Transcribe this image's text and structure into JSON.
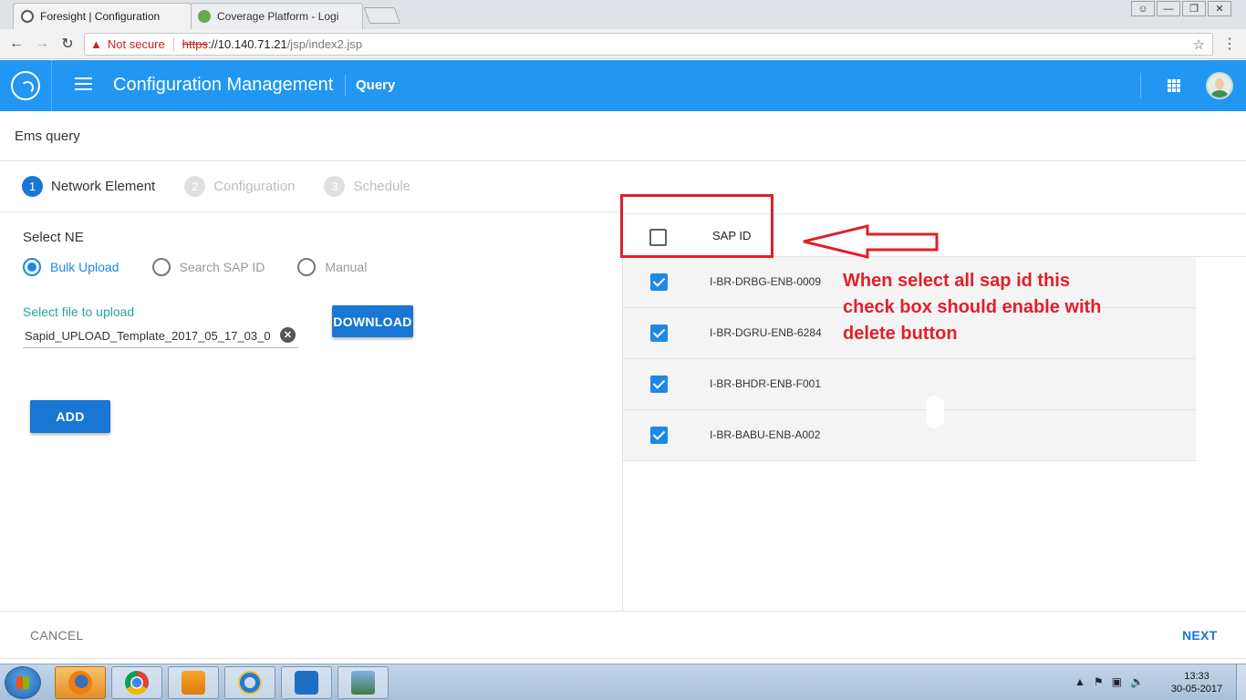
{
  "browser": {
    "tabs": [
      {
        "title": "Foresight | Configuration",
        "active": true
      },
      {
        "title": "Coverage Platform - Logi",
        "active": false
      }
    ],
    "security_label": "Not secure",
    "url_scheme": "https",
    "url_host": "://10.140.71.21",
    "url_path": "/jsp/index2.jsp"
  },
  "app": {
    "title": "Configuration Management",
    "breadcrumb": "Query",
    "brand_color": "#2196f3"
  },
  "page": {
    "title": "Ems query",
    "steps": [
      {
        "number": "1",
        "label": "Network Element",
        "active": true
      },
      {
        "number": "2",
        "label": "Configuration",
        "active": false
      },
      {
        "number": "3",
        "label": "Schedule",
        "active": false
      }
    ],
    "select_ne_label": "Select NE",
    "radios": [
      {
        "label": "Bulk Upload",
        "selected": true
      },
      {
        "label": "Search SAP ID",
        "selected": false
      },
      {
        "label": "Manual",
        "selected": false
      }
    ],
    "file_label": "Select file to upload",
    "file_value": "Sapid_UPLOAD_Template_2017_05_17_03_0",
    "download_label": "DOWNLOAD",
    "add_label": "ADD",
    "cancel_label": "CANCEL",
    "next_label": "NEXT"
  },
  "table": {
    "column_header": "SAP ID",
    "select_all_checked": false,
    "rows": [
      {
        "sap_id": "I-BR-DRBG-ENB-0009",
        "checked": true
      },
      {
        "sap_id": "I-BR-DGRU-ENB-6284",
        "checked": true
      },
      {
        "sap_id": "I-BR-BHDR-ENB-F001",
        "checked": true
      },
      {
        "sap_id": "I-BR-BABU-ENB-A002",
        "checked": true
      }
    ]
  },
  "annotation": {
    "note": "When select all sap id this check box should enable with delete button",
    "color": "#e0202a"
  },
  "taskbar": {
    "time": "13:33",
    "date": "30-05-2017"
  }
}
